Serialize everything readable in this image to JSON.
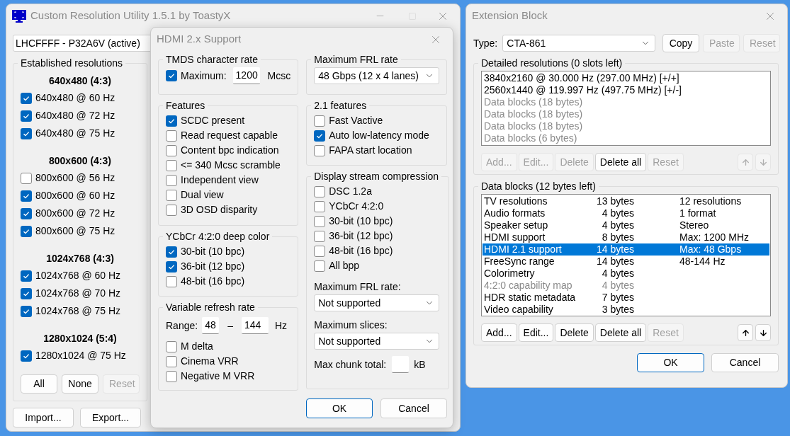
{
  "main_window": {
    "title": "Custom Resolution Utility 1.5.1 by ToastyX",
    "monitor": "LHCFFFF - P32A6V (active)",
    "established": {
      "title": "Established resolutions",
      "groups": [
        {
          "heading": "640x480 (4:3)",
          "items": [
            {
              "label": "640x480 @ 60 Hz",
              "checked": true
            },
            {
              "label": "640x480 @ 72 Hz",
              "checked": true
            },
            {
              "label": "640x480 @ 75 Hz",
              "checked": true
            }
          ]
        },
        {
          "heading": "800x600 (4:3)",
          "items": [
            {
              "label": "800x600 @ 56 Hz",
              "checked": false
            },
            {
              "label": "800x600 @ 60 Hz",
              "checked": true
            },
            {
              "label": "800x600 @ 72 Hz",
              "checked": true
            },
            {
              "label": "800x600 @ 75 Hz",
              "checked": true
            }
          ]
        },
        {
          "heading": "1024x768 (4:3)",
          "items": [
            {
              "label": "1024x768 @ 60 Hz",
              "checked": true
            },
            {
              "label": "1024x768 @ 70 Hz",
              "checked": true
            },
            {
              "label": "1024x768 @ 75 Hz",
              "checked": true
            }
          ]
        },
        {
          "heading": "1280x1024 (5:4)",
          "items": [
            {
              "label": "1280x1024 @ 75 Hz",
              "checked": true
            }
          ]
        }
      ],
      "buttons": [
        {
          "label": "All",
          "disabled": false
        },
        {
          "label": "None",
          "disabled": false
        },
        {
          "label": "Reset",
          "disabled": true
        }
      ]
    },
    "bottom_buttons": [
      {
        "label": "Import...",
        "disabled": false
      },
      {
        "label": "Export...",
        "disabled": false
      }
    ]
  },
  "hdmi_dialog": {
    "title": "HDMI 2.x Support",
    "tmds": {
      "title": "TMDS character rate",
      "label": "Maximum:",
      "checked": true,
      "value": "1200",
      "unit": "Mcsc"
    },
    "features": {
      "title": "Features",
      "items": [
        {
          "label": "SCDC present",
          "checked": true
        },
        {
          "label": "Read request capable",
          "checked": false
        },
        {
          "label": "Content bpc indication",
          "checked": false
        },
        {
          "label": "<= 340 Mcsc scramble",
          "checked": false
        },
        {
          "label": "Independent view",
          "checked": false
        },
        {
          "label": "Dual view",
          "checked": false
        },
        {
          "label": "3D OSD disparity",
          "checked": false
        }
      ]
    },
    "deep_color": {
      "title": "YCbCr 4:2:0 deep color",
      "items": [
        {
          "label": "30-bit (10 bpc)",
          "checked": true
        },
        {
          "label": "36-bit (12 bpc)",
          "checked": true
        },
        {
          "label": "48-bit (16 bpc)",
          "checked": false
        }
      ]
    },
    "vrr": {
      "title": "Variable refresh rate",
      "range_label": "Range:",
      "min": "48",
      "separator": "–",
      "max": "144",
      "unit": "Hz",
      "items": [
        {
          "label": "M delta",
          "checked": false
        },
        {
          "label": "Cinema VRR",
          "checked": false
        },
        {
          "label": "Negative M VRR",
          "checked": false
        }
      ]
    },
    "frl": {
      "title": "Maximum FRL rate",
      "value": "48 Gbps (12 x 4 lanes)"
    },
    "features_21": {
      "title": "2.1 features",
      "items": [
        {
          "label": "Fast Vactive",
          "checked": false
        },
        {
          "label": "Auto low-latency mode",
          "checked": true
        },
        {
          "label": "FAPA start location",
          "checked": false
        }
      ]
    },
    "dsc": {
      "title": "Display stream compression",
      "items": [
        {
          "label": "DSC 1.2a",
          "checked": false
        },
        {
          "label": "YCbCr 4:2:0",
          "checked": false
        },
        {
          "label": "30-bit (10 bpc)",
          "checked": false
        },
        {
          "label": "36-bit (12 bpc)",
          "checked": false
        },
        {
          "label": "48-bit (16 bpc)",
          "checked": false
        },
        {
          "label": "All bpp",
          "checked": false
        }
      ],
      "selects": [
        {
          "label": "Maximum FRL rate:",
          "value": "Not supported"
        },
        {
          "label": "Maximum slices:",
          "value": "Not supported"
        }
      ],
      "chunk_label": "Max chunk total:",
      "chunk_unit": "kB"
    },
    "buttons": [
      {
        "label": "OK",
        "default": true
      },
      {
        "label": "Cancel",
        "default": false
      }
    ]
  },
  "extension_block": {
    "title": "Extension Block",
    "type_label": "Type:",
    "type": "CTA-861",
    "type_buttons": [
      {
        "label": "Copy",
        "disabled": false
      },
      {
        "label": "Paste",
        "disabled": true
      },
      {
        "label": "Reset",
        "disabled": true
      }
    ],
    "detailed": {
      "title": "Detailed resolutions (0 slots left)",
      "items": [
        {
          "label": "3840x2160 @ 30.000 Hz (297.00 MHz) [+/+]",
          "disabled": false
        },
        {
          "label": "2560x1440 @ 119.997 Hz (497.75 MHz) [+/-]",
          "disabled": false
        },
        {
          "label": "Data blocks (18 bytes)",
          "disabled": true
        },
        {
          "label": "Data blocks (18 bytes)",
          "disabled": true
        },
        {
          "label": "Data blocks (18 bytes)",
          "disabled": true
        },
        {
          "label": "Data blocks (6 bytes)",
          "disabled": true
        }
      ],
      "buttons": [
        {
          "label": "Add...",
          "disabled": true
        },
        {
          "label": "Edit...",
          "disabled": true
        },
        {
          "label": "Delete",
          "disabled": true
        },
        {
          "label": "Delete all",
          "disabled": false
        },
        {
          "label": "Reset",
          "disabled": true
        }
      ],
      "arrows_disabled": true
    },
    "data_blocks": {
      "title": "Data blocks (12 bytes left)",
      "rows": [
        {
          "name": "TV resolutions",
          "size": "13 bytes",
          "info": "12 resolutions",
          "selected": false,
          "disabled": false
        },
        {
          "name": "Audio formats",
          "size": "4 bytes",
          "info": "1 format",
          "selected": false,
          "disabled": false
        },
        {
          "name": "Speaker setup",
          "size": "4 bytes",
          "info": "Stereo",
          "selected": false,
          "disabled": false
        },
        {
          "name": "HDMI support",
          "size": "8 bytes",
          "info": "Max: 1200 MHz",
          "selected": false,
          "disabled": false
        },
        {
          "name": "HDMI 2.1 support",
          "size": "14 bytes",
          "info": "Max: 48 Gbps",
          "selected": true,
          "disabled": false
        },
        {
          "name": "FreeSync range",
          "size": "14 bytes",
          "info": "48-144 Hz",
          "selected": false,
          "disabled": false
        },
        {
          "name": "Colorimetry",
          "size": "4 bytes",
          "selected": false,
          "disabled": false
        },
        {
          "name": "4:2:0 capability map",
          "size": "4 bytes",
          "selected": false,
          "disabled": true
        },
        {
          "name": "HDR static metadata",
          "size": "7 bytes",
          "selected": false,
          "disabled": false
        },
        {
          "name": "Video capability",
          "size": "3 bytes",
          "selected": false,
          "disabled": false
        }
      ],
      "buttons": [
        {
          "label": "Add...",
          "disabled": false
        },
        {
          "label": "Edit...",
          "disabled": false
        },
        {
          "label": "Delete",
          "disabled": false
        },
        {
          "label": "Delete all",
          "disabled": false
        },
        {
          "label": "Reset",
          "disabled": true
        }
      ],
      "arrows_disabled": false
    },
    "buttons": [
      {
        "label": "OK",
        "default": true
      },
      {
        "label": "Cancel",
        "default": false
      }
    ]
  }
}
